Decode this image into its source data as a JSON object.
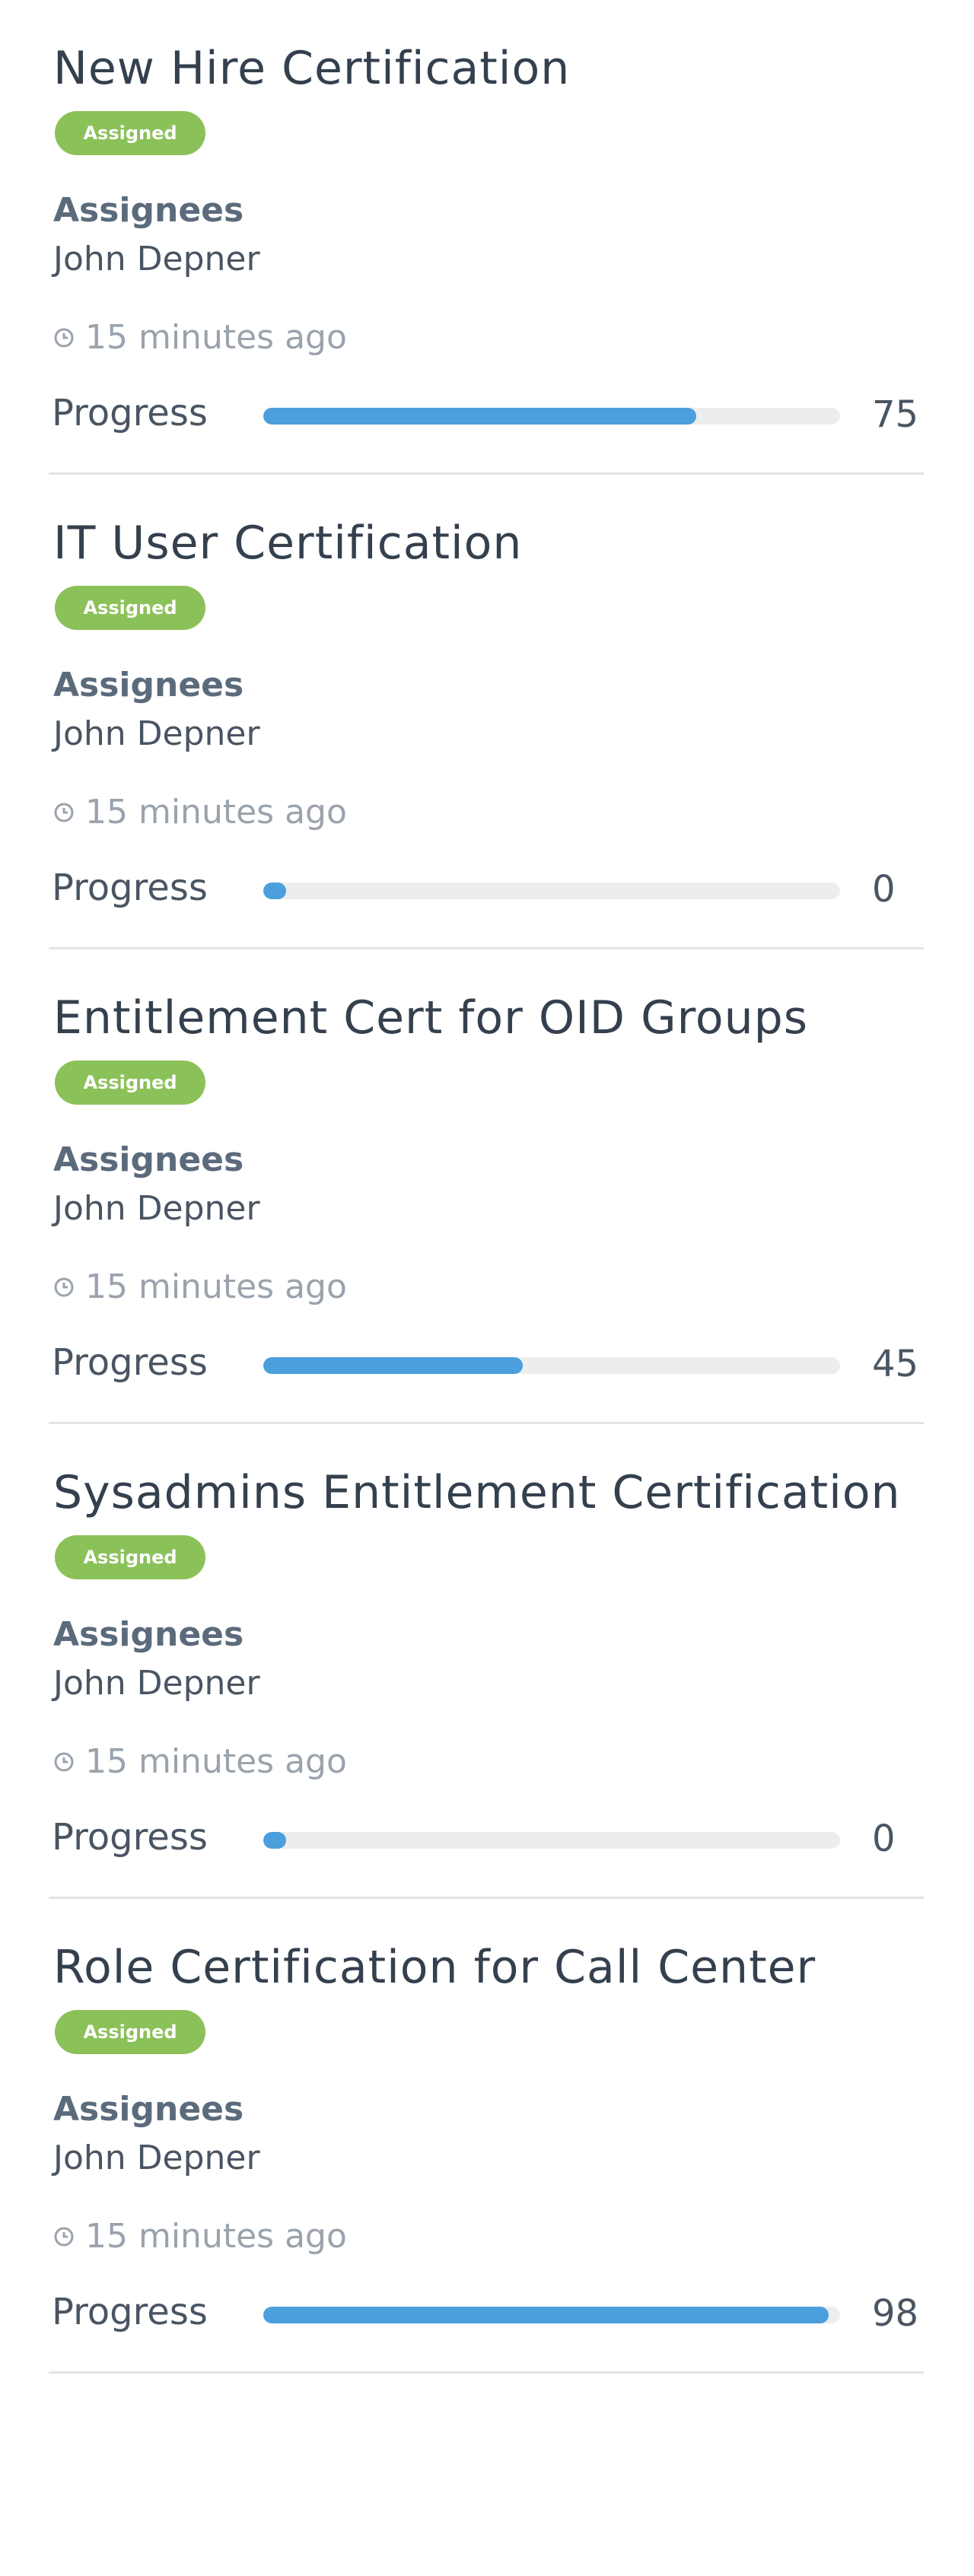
{
  "certifications": [
    {
      "title": "New Hire Certification",
      "status": "Assigned",
      "assignees_label": "Assignees",
      "assignee": "John Depner",
      "time": "15 minutes ago",
      "progress_label": "Progress",
      "progress": 75,
      "progress_text": "75"
    },
    {
      "title": "IT User Certification",
      "status": "Assigned",
      "assignees_label": "Assignees",
      "assignee": "John Depner",
      "time": "15 minutes ago",
      "progress_label": "Progress",
      "progress": 0,
      "progress_text": "0"
    },
    {
      "title": "Entitlement Cert for OID Groups",
      "status": "Assigned",
      "assignees_label": "Assignees",
      "assignee": "John Depner",
      "time": "15 minutes ago",
      "progress_label": "Progress",
      "progress": 45,
      "progress_text": "45"
    },
    {
      "title": "Sysadmins Entitlement Certification",
      "status": "Assigned",
      "assignees_label": "Assignees",
      "assignee": "John Depner",
      "time": "15 minutes ago",
      "progress_label": "Progress",
      "progress": 0,
      "progress_text": "0"
    },
    {
      "title": "Role Certification for Call Center",
      "status": "Assigned",
      "assignees_label": "Assignees",
      "assignee": "John Depner",
      "time": "15 minutes ago",
      "progress_label": "Progress",
      "progress": 98,
      "progress_text": "98"
    }
  ],
  "colors": {
    "badge": "#8bc159",
    "progress_fill": "#4a9fdc",
    "progress_track": "#eceeee",
    "divider": "#e2e5e8"
  },
  "icons": {
    "time": "clock-icon"
  }
}
